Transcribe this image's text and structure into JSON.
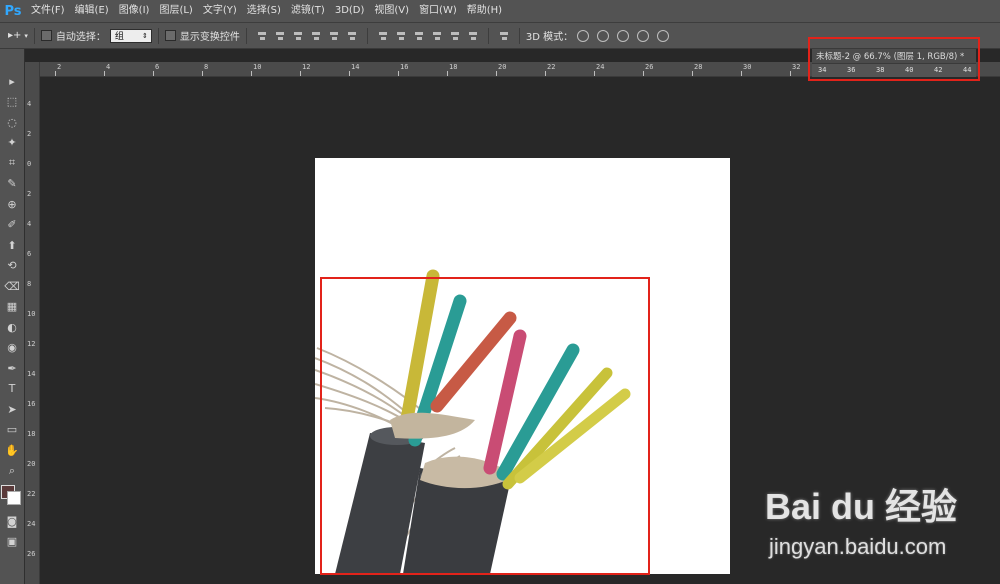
{
  "app": {
    "logo": "Ps"
  },
  "menu": [
    "文件(F)",
    "编辑(E)",
    "图像(I)",
    "图层(L)",
    "文字(Y)",
    "选择(S)",
    "滤镜(T)",
    "3D(D)",
    "视图(V)",
    "窗口(W)",
    "帮助(H)"
  ],
  "options": {
    "move_tool": "▸+",
    "auto_select_label": "自动选择：",
    "auto_select_value": "组",
    "show_transform_label": "显示变换控件",
    "mode_3d_label": "3D 模式："
  },
  "document": {
    "tab_title": "未标题-2 @ 66.7% (图层 1, RGB/8) *",
    "ruler_ticks": [
      "34",
      "36",
      "38",
      "40",
      "42",
      "44"
    ]
  },
  "rulers": {
    "h_ticks": [
      "2",
      "4",
      "6",
      "8",
      "10",
      "12",
      "14",
      "16",
      "18",
      "20",
      "22",
      "24",
      "26",
      "28",
      "30",
      "32"
    ],
    "v_ticks": [
      "4",
      "2",
      "0",
      "2",
      "4",
      "6",
      "8",
      "10",
      "12",
      "14",
      "16",
      "18",
      "20",
      "22",
      "24",
      "26"
    ]
  },
  "tools": [
    "▸",
    "⬚",
    "◌",
    "✦",
    "⌗",
    "✎",
    "⊕",
    "✐",
    "⬆",
    "⟲",
    "⌫",
    "▦",
    "◐",
    "◉",
    "✒",
    "T",
    "➤",
    "▭",
    "✋",
    "⌕"
  ],
  "colors": {
    "accent": "#31a8ff",
    "highlight": "#e2231a",
    "panel": "#535353",
    "workspace": "#282828"
  },
  "watermark": {
    "brand": "Bai du 经验",
    "url": "jingyan.baidu.com"
  }
}
